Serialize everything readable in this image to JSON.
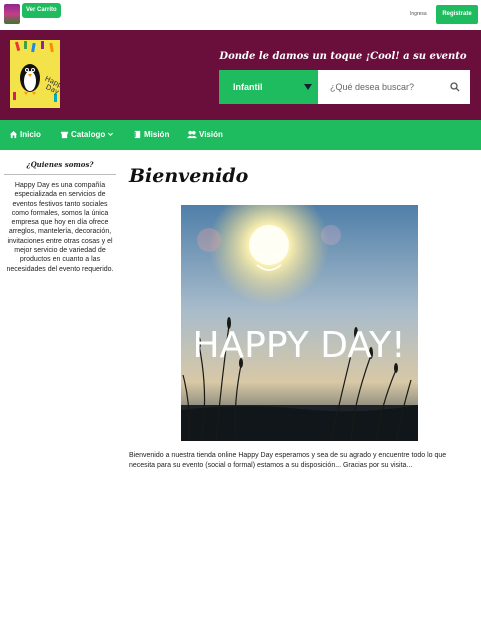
{
  "topbar": {
    "cart_label": "Ver Carrito",
    "login_label": "Ingresa",
    "register_label": "Registrate"
  },
  "header": {
    "slogan": "Donde le damos un toque ¡Cool! a su evento",
    "logo_text": "Happy Day"
  },
  "search": {
    "category_value": "Infantil",
    "placeholder": "¿Qué desea buscar?"
  },
  "nav": {
    "items": [
      {
        "label": "Inicio",
        "icon": "home-icon"
      },
      {
        "label": "Catalogo",
        "icon": "store-icon"
      },
      {
        "label": "Misión",
        "icon": "book-icon"
      },
      {
        "label": "Visión",
        "icon": "users-icon"
      }
    ]
  },
  "sidebar": {
    "title": "¿Quienes somos?",
    "text": "Happy Day es una compañía especializada en servicios de eventos festivos tanto sociales como formales, somos la única empresa que hoy en día ofrece arreglos, mantelería, decoración, invitaciones entre otras cosas y el mejor servicio de variedad de productos en cuanto a las necesidades del evento requerido."
  },
  "main": {
    "title": "Bienvenido",
    "hero_text": "HAPPY DAY!",
    "welcome_text": "Bienvenido a nuestra tienda online Happy Day esperamos y sea de su agrado y encuentre todo lo que necesita para su evento (social o formal) estamos a su disposición... Gracias por su visita..."
  },
  "colors": {
    "brand_green": "#1ebb5f",
    "header_maroon": "#6a0f3c"
  }
}
